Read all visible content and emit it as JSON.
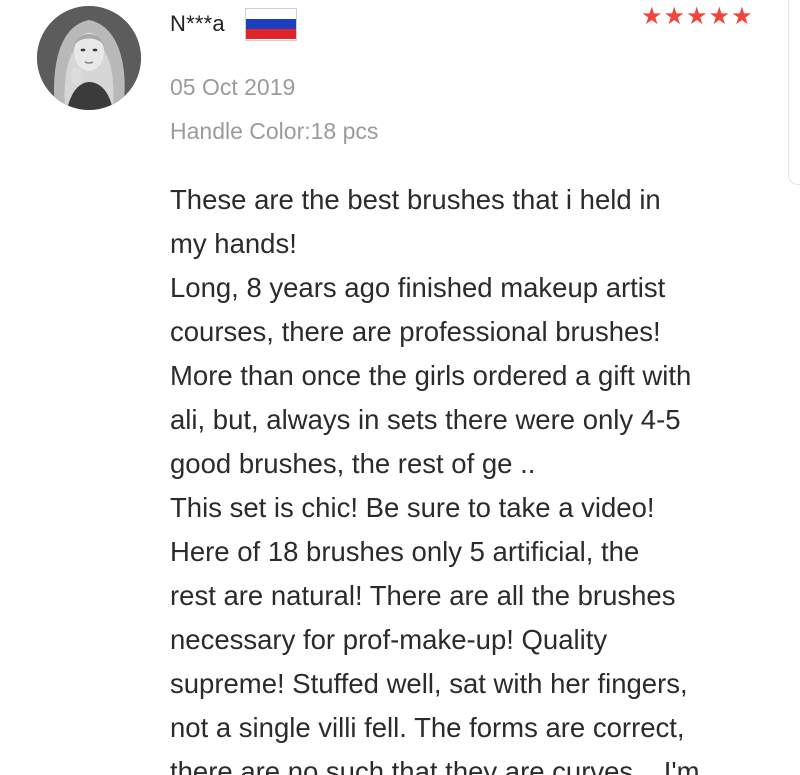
{
  "review": {
    "username": "N***a",
    "country_flag": "russia-flag",
    "flag_colors": [
      "#ffffff",
      "#1a3fbf",
      "#e0242b"
    ],
    "rating": 5,
    "rating_max": 5,
    "star_color": "#f0463c",
    "date": "05 Oct 2019",
    "variant": "Handle Color:18 pcs",
    "text_lines": [
      "These are the best brushes that i held in",
      "my hands!",
      "Long, 8 years ago finished makeup artist",
      "courses, there are professional brushes!",
      "More than once the girls ordered a gift with",
      "ali, but, always in sets there were only 4-5",
      "good brushes, the rest of ge ..",
      "This set is chic! Be sure to take a video!",
      "Here of 18 brushes only 5 artificial, the",
      "rest are natural! There are all the brushes",
      "necessary for prof-make-up! Quality",
      "supreme! Stuffed well, sat with her fingers,",
      "not a single villi fell. The forms are correct,",
      "there are no such that they are curves... I'm"
    ]
  }
}
